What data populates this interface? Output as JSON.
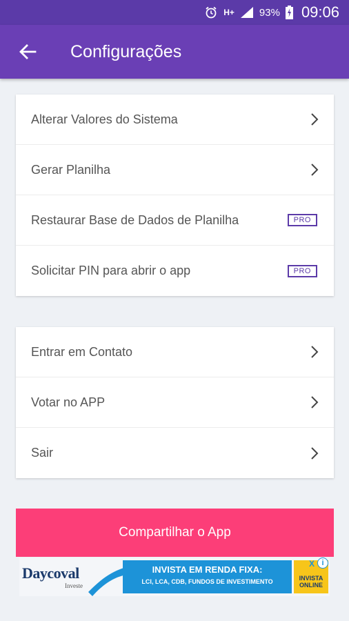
{
  "status_bar": {
    "network": "H+",
    "battery_percent": "93%",
    "time": "09:06",
    "icons": [
      "alarm-icon",
      "network-type-icon",
      "signal-icon",
      "battery-charging-icon"
    ]
  },
  "app_bar": {
    "title": "Configurações",
    "back_icon": "arrow-left-icon"
  },
  "settings_group_1": {
    "items": [
      {
        "label": "Alterar Valores do Sistema",
        "trailing": "chevron-right-icon"
      },
      {
        "label": "Gerar Planilha",
        "trailing": "chevron-right-icon"
      },
      {
        "label": "Restaurar Base de Dados de Planilha",
        "badge": "PRO"
      },
      {
        "label": "Solicitar PIN para abrir o app",
        "badge": "PRO"
      }
    ]
  },
  "settings_group_2": {
    "items": [
      {
        "label": "Entrar em Contato",
        "trailing": "chevron-right-icon"
      },
      {
        "label": "Votar no APP",
        "trailing": "chevron-right-icon"
      },
      {
        "label": "Sair",
        "trailing": "chevron-right-icon"
      }
    ]
  },
  "share_button": {
    "label": "Compartilhar o App"
  },
  "ad": {
    "brand": "Daycoval",
    "brand_sub": "Investe",
    "headline": "INVISTA EM RENDA FIXA:",
    "subline": "LCI, LCA, CDB, FUNDOS DE INVESTIMENTO",
    "cta": "INVISTA ONLINE",
    "info": "i",
    "close": "X"
  },
  "colors": {
    "status_bar": "#5b3aa8",
    "app_bar": "#6a3fb5",
    "background": "#eef1f5",
    "share_button": "#fc3e78",
    "pro_badge": "#5b3aa8",
    "ad_blue": "#1d93d8",
    "ad_yellow": "#f7c51a"
  }
}
